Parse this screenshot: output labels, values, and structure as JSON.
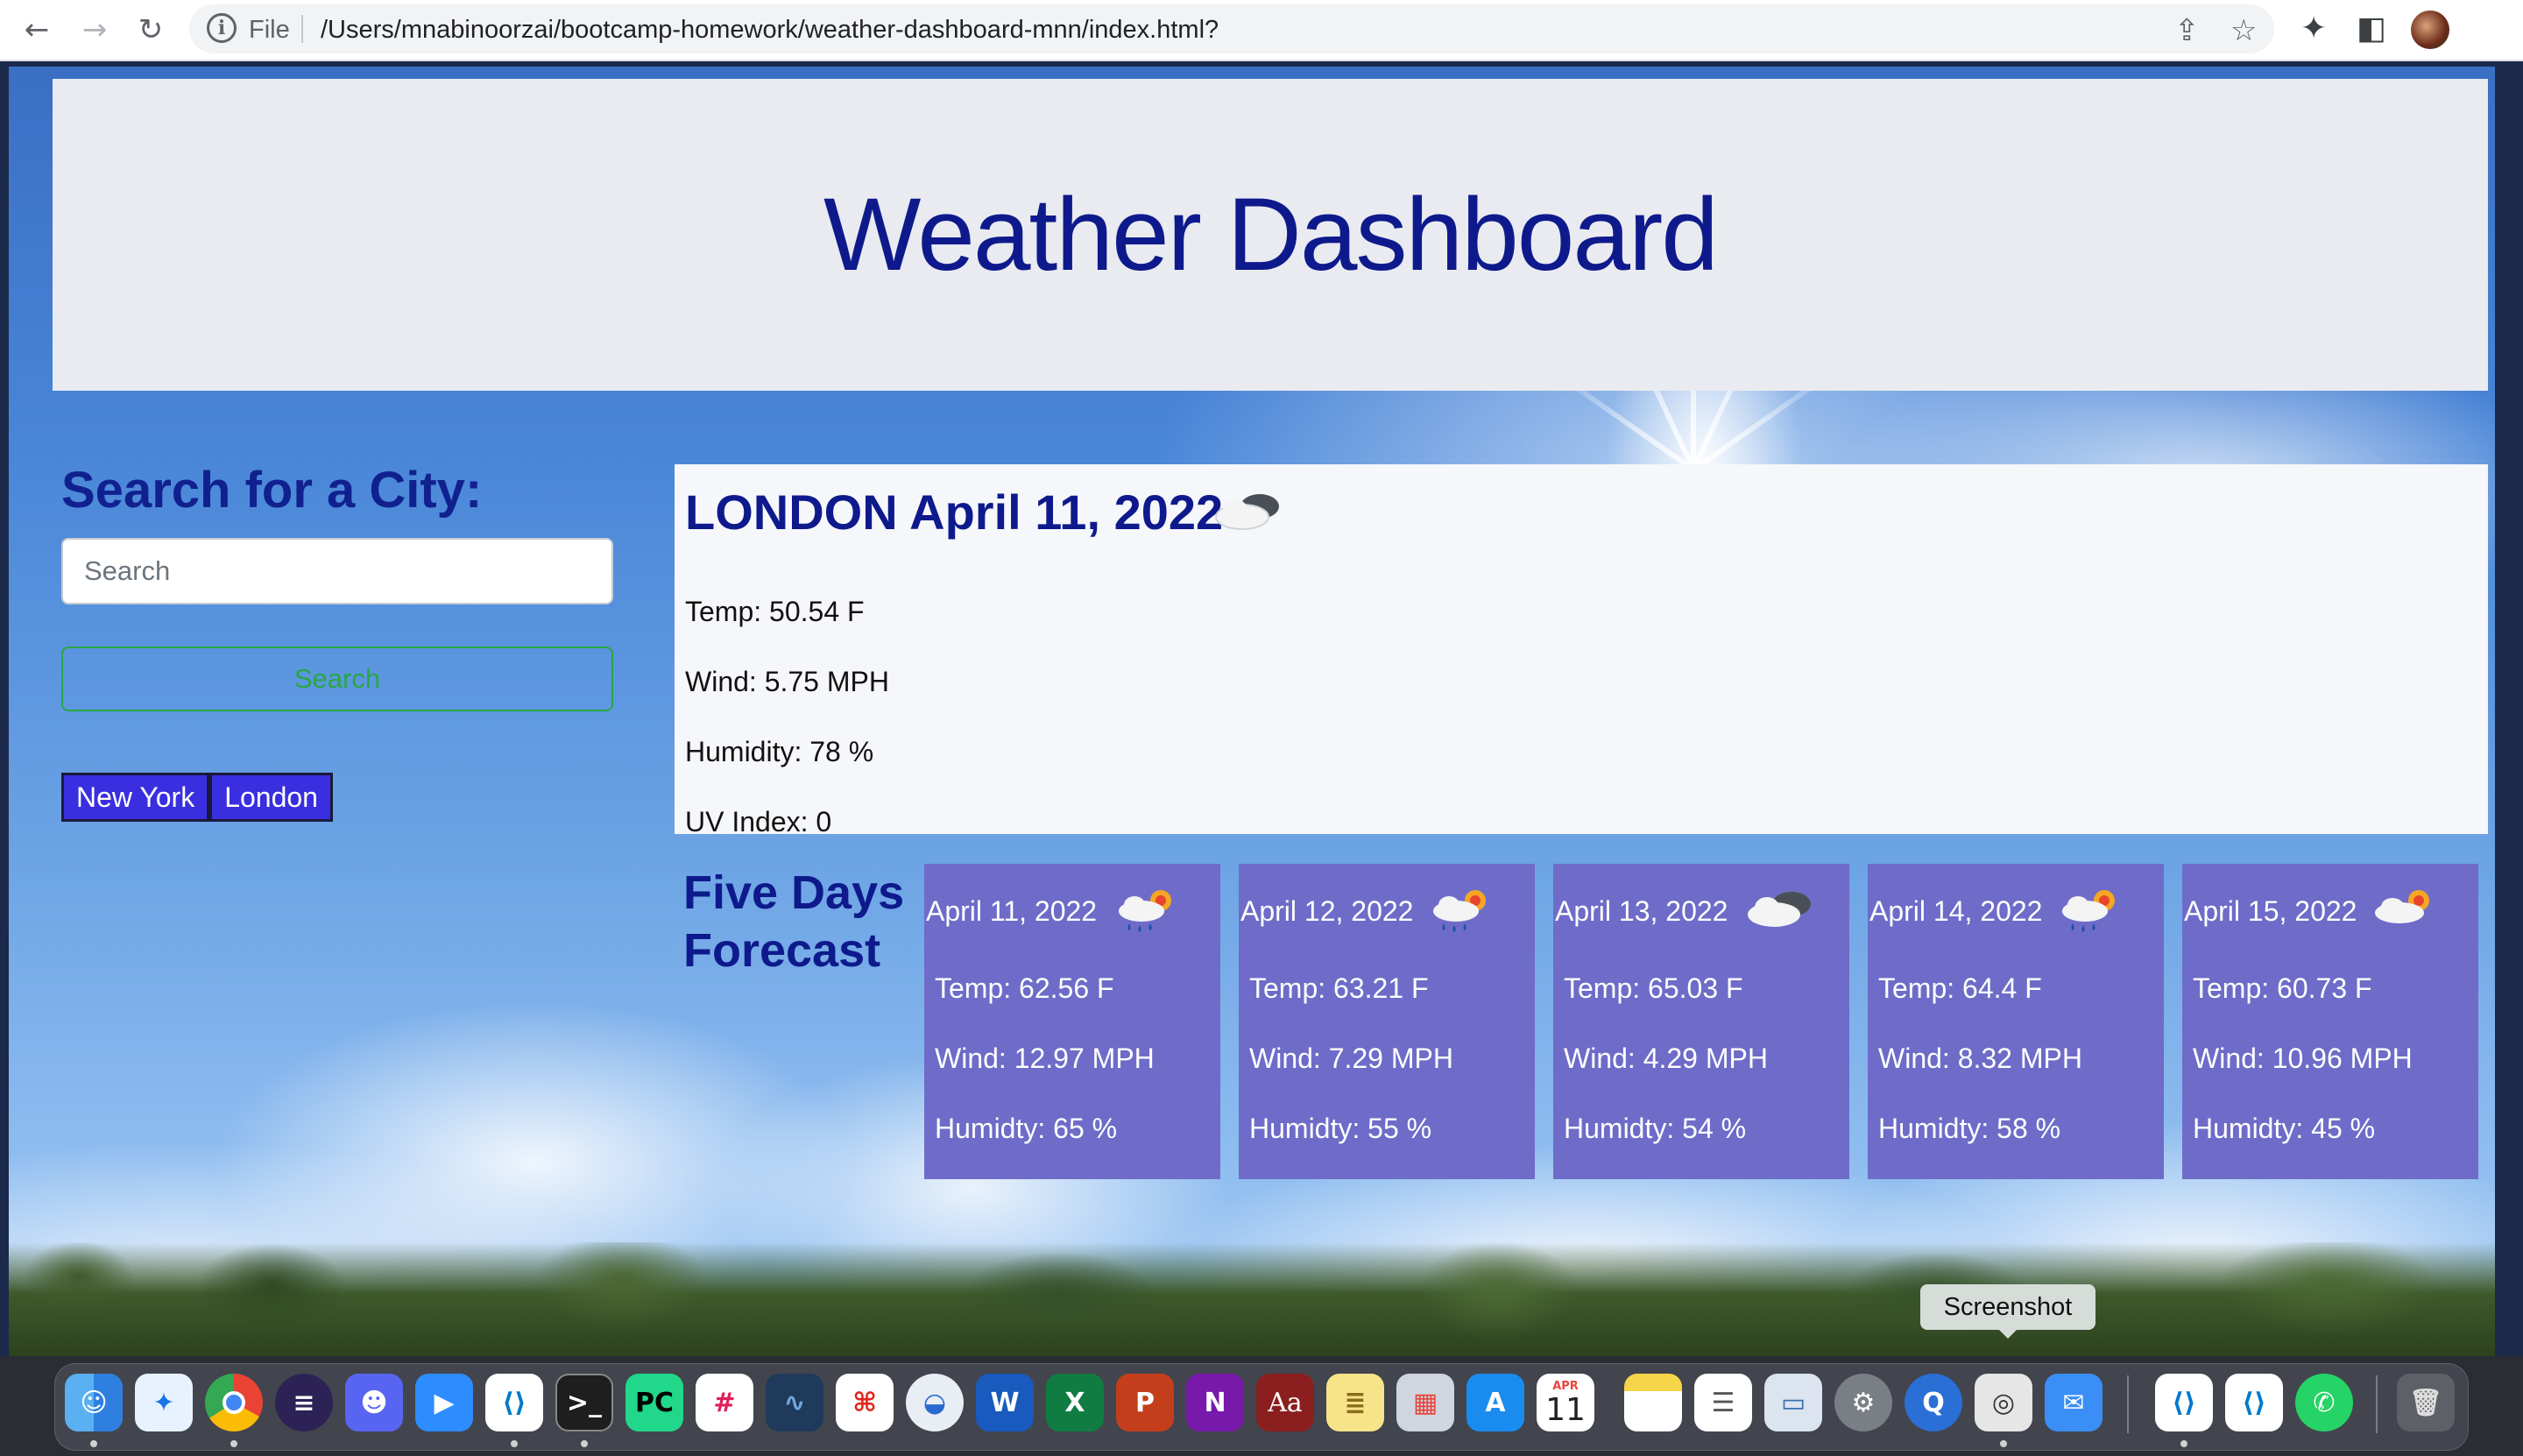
{
  "browser": {
    "file_label": "File",
    "url": "/Users/mnabinoorzai/bootcamp-homework/weather-dashboard-mnn/index.html?"
  },
  "page": {
    "title": "Weather Dashboard"
  },
  "search": {
    "title": "Search for a City:",
    "placeholder": "Search",
    "button_label": "Search",
    "history": [
      "New York",
      "London"
    ]
  },
  "current": {
    "heading": "LONDON April 11, 2022",
    "icon": "cloudy-night-icon",
    "temp": "Temp: 50.54 F",
    "wind": "Wind: 5.75 MPH",
    "humidity": "Humidity: 78 %",
    "uv": "UV Index: 0"
  },
  "forecast": {
    "title": "Five Days Forecast",
    "days": [
      {
        "date": "April 11, 2022",
        "icon": "rain-sun-icon",
        "temp": "Temp: 62.56 F",
        "wind": "Wind: 12.97 MPH",
        "humidity": "Humidty: 65 %"
      },
      {
        "date": "April 12, 2022",
        "icon": "rain-sun-icon",
        "temp": "Temp: 63.21 F",
        "wind": "Wind: 7.29 MPH",
        "humidity": "Humidty: 55 %"
      },
      {
        "date": "April 13, 2022",
        "icon": "cloudy-night-icon",
        "temp": "Temp: 65.03 F",
        "wind": "Wind: 4.29 MPH",
        "humidity": "Humidty: 54 %"
      },
      {
        "date": "April 14, 2022",
        "icon": "rain-sun-icon",
        "temp": "Temp: 64.4 F",
        "wind": "Wind: 8.32 MPH",
        "humidity": "Humidty: 58 %"
      },
      {
        "date": "April 15, 2022",
        "icon": "cloud-sun-icon",
        "temp": "Temp: 60.73 F",
        "wind": "Wind: 10.96 MPH",
        "humidity": "Humidty: 45 %"
      }
    ]
  },
  "tooltip": {
    "label": "Screenshot"
  },
  "dock": {
    "calendar_month": "APR",
    "calendar_day": "11",
    "pycharm_label": "PC",
    "word_label": "W",
    "excel_label": "X",
    "powerpoint_label": "P",
    "onenote_label": "N",
    "dictionary_label": "Aa"
  },
  "colors": {
    "title_blue": "#0e1a8c",
    "card_purple": "#6e6cc8",
    "history_button": "#3a2fe0",
    "search_green": "#28a745"
  }
}
